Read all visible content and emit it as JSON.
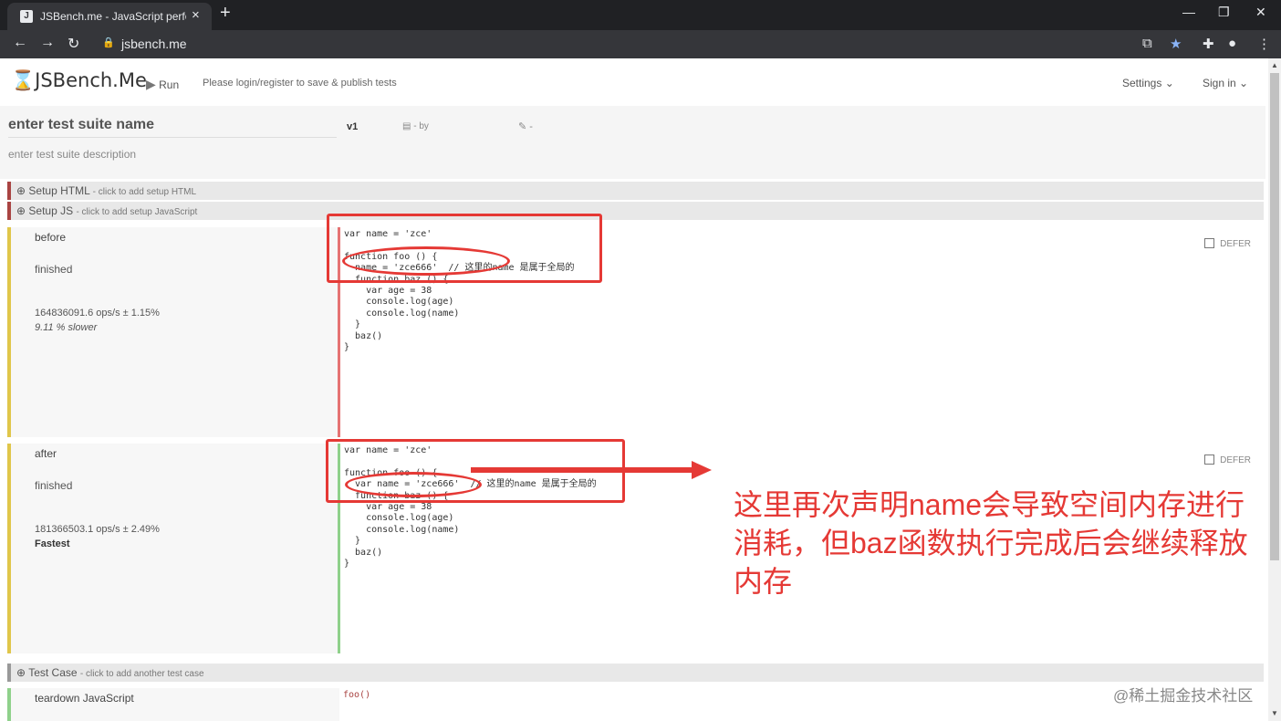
{
  "browser": {
    "tab_title": "JSBench.me - JavaScript perfo",
    "url": "jsbench.me"
  },
  "header": {
    "logo": "JSBench.Me",
    "run": "Run",
    "login_prompt": "Please login/register to save & publish tests",
    "settings": "Settings",
    "signin": "Sign in"
  },
  "meta": {
    "suite_name": "enter test suite name",
    "version": "v1",
    "by": "- by",
    "pen_dash": "-",
    "description": "enter test suite description"
  },
  "setup_html": {
    "label": "Setup HTML",
    "hint": "- click to add setup HTML"
  },
  "setup_js": {
    "label": "Setup JS",
    "hint": "- click to add setup JavaScript"
  },
  "cases": [
    {
      "name": "before",
      "status": "finished",
      "ops": "164836091.6 ops/s ± 1.15%",
      "comparison": "9.11 % slower",
      "defer": "DEFER",
      "code": [
        "var name = 'zce'",
        "",
        "function foo () {",
        "  name = 'zce666'  // 这里的name 是属于全局的",
        "  function baz () {",
        "    var age = 38",
        "    console.log(age)",
        "    console.log(name)",
        "  }",
        "  baz()",
        "}"
      ]
    },
    {
      "name": "after",
      "status": "finished",
      "ops": "181366503.1 ops/s ± 2.49%",
      "comparison": "Fastest",
      "defer": "DEFER",
      "code": [
        "var name = 'zce'",
        "",
        "function foo () {",
        "  var name = 'zce666'  // 这里的name 是属于全局的",
        "  function baz () {",
        "    var age = 38",
        "    console.log(age)",
        "    console.log(name)",
        "  }",
        "  baz()",
        "}"
      ]
    }
  ],
  "test_case": {
    "label": "Test Case",
    "hint": "- click to add another test case"
  },
  "teardown": {
    "label": "teardown JavaScript",
    "code": "foo()"
  },
  "annotation": "这里再次声明name会导致空间内存进行消耗，但baz函数执行完成后会继续释放内存",
  "watermark": "@稀土掘金技术社区",
  "colors": {
    "annotation": "#e53935",
    "before_bar": "#e57373",
    "after_bar": "#8fd18b"
  }
}
